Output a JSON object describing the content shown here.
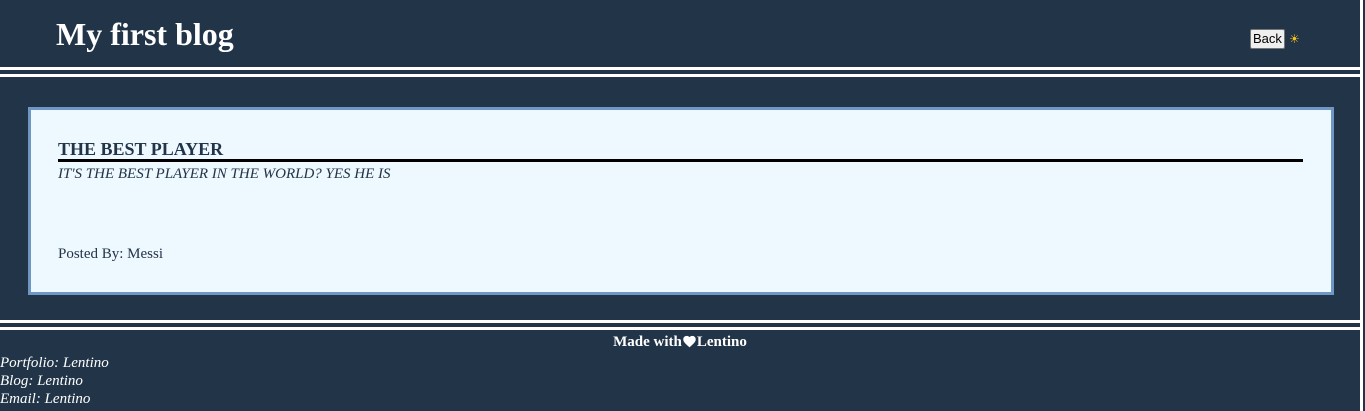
{
  "header": {
    "title": "My first blog",
    "back_label": "Back",
    "theme_icon": "sun-icon",
    "theme_glyph": "☀"
  },
  "post": {
    "title": "THE BEST PLAYER",
    "subtitle": "IT'S THE BEST PLAYER IN THE WORLD? YES HE IS",
    "author_label": "Posted By: Messi"
  },
  "footer": {
    "made_with": "Made with",
    "author": "Lentino",
    "heart_icon": "heart-icon",
    "links": {
      "portfolio": "Portfolio: Lentino",
      "blog": "Blog: Lentino",
      "email": "Email: Lentino"
    }
  },
  "colors": {
    "background": "#223448",
    "card_background": "#eef8ff",
    "card_border": "#6f97c3",
    "text_light": "#ffffff",
    "text_dark": "#223448",
    "accent_sun": "#f5c518"
  }
}
